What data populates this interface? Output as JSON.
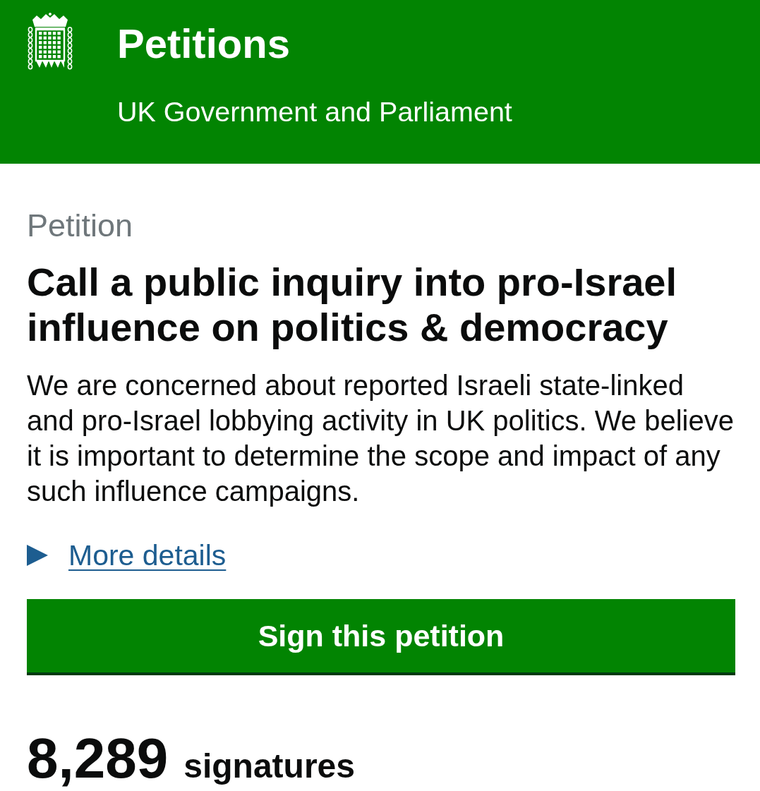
{
  "header": {
    "title": "Petitions",
    "subtitle": "UK Government and Parliament"
  },
  "petition": {
    "label": "Petition",
    "title": "Call a public inquiry into pro-Israel influence on politics & democracy",
    "summary": "We are concerned about reported Israeli state-linked and pro-Israel lobbying activity in UK politics. We believe it is important to determine the scope and impact of any such influence campaigns.",
    "details": {
      "label": "More details",
      "expanded": false
    },
    "sign_button": "Sign this petition",
    "signatures": {
      "count": "8,289",
      "label": "signatures"
    }
  }
}
